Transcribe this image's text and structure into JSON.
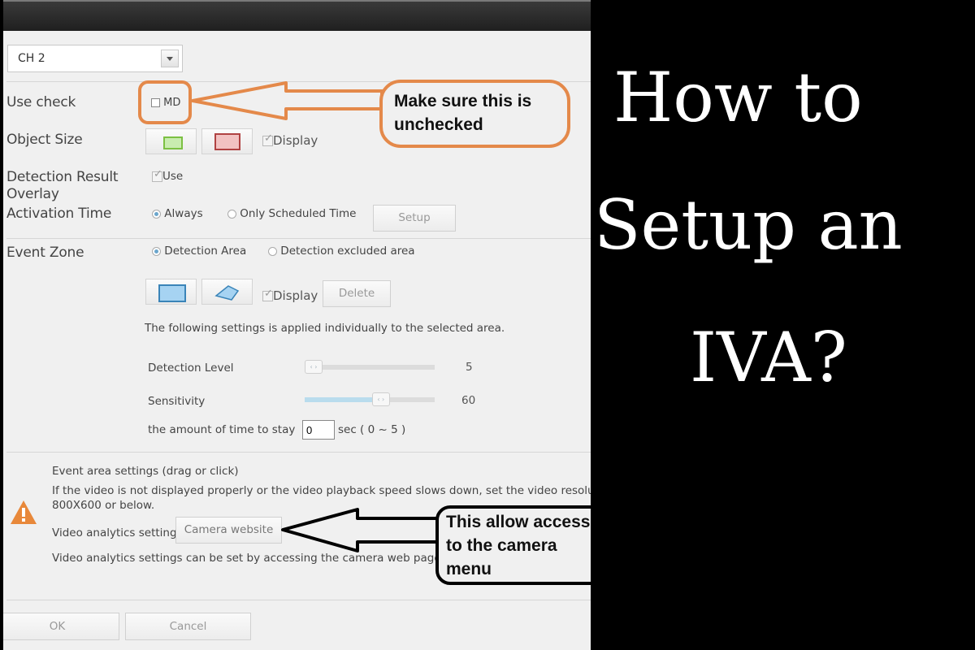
{
  "dialog": {
    "channel_select": {
      "value": "CH 2"
    },
    "use_check": {
      "label": "Use check",
      "option": "MD",
      "checked": false
    },
    "object_size": {
      "label": "Object Size",
      "display_label": "Display",
      "display_checked": true
    },
    "detection_overlay": {
      "label_line1": "Detection Result",
      "label_line2": "Overlay",
      "option": "Use",
      "checked": true
    },
    "activation_time": {
      "label": "Activation Time",
      "options": [
        "Always",
        "Only Scheduled Time"
      ],
      "selected": "Always",
      "setup_button": "Setup"
    },
    "event_zone": {
      "label": "Event Zone",
      "options": [
        "Detection Area",
        "Detection excluded area"
      ],
      "selected": "Detection Area",
      "display_label": "Display",
      "display_checked": true,
      "delete_button": "Delete",
      "note": "The following settings is applied individually to the selected area."
    },
    "detection_level": {
      "label": "Detection Level",
      "value": "5",
      "fraction": 0.0
    },
    "sensitivity": {
      "label": "Sensitivity",
      "value": "60",
      "fraction": 0.6
    },
    "stay_time": {
      "label": "the amount of time to stay",
      "value": "0",
      "unit_range": "sec ( 0 ~ 5 )"
    },
    "info": {
      "line1": "Event area settings (drag or click)",
      "line2": "If the video is not displayed properly or the video playback speed slows down, set the video resolution to",
      "line3": "800X600 or below.",
      "video_analytics_label": "Video analytics setting",
      "camera_website_button": "Camera website",
      "line5": "Video analytics settings can be set by accessing the camera web page.",
      "warning_color": "#e8883a"
    },
    "footer": {
      "ok_button": "OK",
      "cancel_button": "Cancel"
    }
  },
  "annotations": {
    "callout1": {
      "line1": "Make sure this is",
      "line2": "unchecked",
      "color": "#e4894a"
    },
    "callout2": {
      "line1": "This allow access",
      "line2": "to the camera",
      "line3": "menu",
      "color": "#000000"
    }
  },
  "headline": {
    "line1": "How to",
    "line2": "Setup an",
    "line3": "IVA?"
  }
}
